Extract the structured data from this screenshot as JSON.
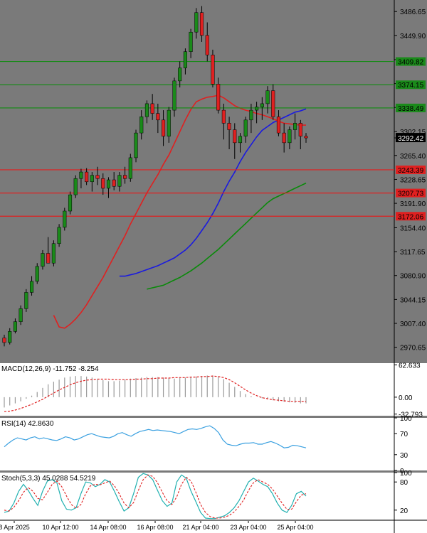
{
  "chart_data": [
    {
      "type": "candlestick",
      "panel": "price",
      "ylim": [
        2955,
        3500
      ],
      "y_ticks": [
        "3486.65",
        "3449.90",
        "3412.75",
        "3375.90",
        "3339.15",
        "3302.15",
        "3265.40",
        "3228.65",
        "3191.90",
        "3154.40",
        "3117.65",
        "3080.90",
        "3044.15",
        "3007.40",
        "2970.65"
      ],
      "last_price": "3292.42",
      "last_price_color": "#000000",
      "up_color": "#1a8a1a",
      "down_color": "#e02020",
      "candles": [
        [
          2985,
          2990,
          2972,
          2978
        ],
        [
          2978,
          3000,
          2975,
          2995
        ],
        [
          2995,
          3015,
          2992,
          3010
        ],
        [
          3010,
          3035,
          3005,
          3030
        ],
        [
          3030,
          3060,
          3025,
          3055
        ],
        [
          3055,
          3080,
          3050,
          3072
        ],
        [
          3072,
          3100,
          3068,
          3095
        ],
        [
          3095,
          3120,
          3090,
          3115
        ],
        [
          3115,
          3140,
          3110,
          3100
        ],
        [
          3100,
          3135,
          3095,
          3130
        ],
        [
          3130,
          3160,
          3125,
          3155
        ],
        [
          3155,
          3185,
          3150,
          3180
        ],
        [
          3180,
          3210,
          3175,
          3205
        ],
        [
          3205,
          3235,
          3200,
          3230
        ],
        [
          3230,
          3245,
          3215,
          3240
        ],
        [
          3240,
          3246,
          3220,
          3225
        ],
        [
          3225,
          3240,
          3210,
          3235
        ],
        [
          3235,
          3248,
          3220,
          3230
        ],
        [
          3230,
          3238,
          3205,
          3215
        ],
        [
          3215,
          3232,
          3200,
          3228
        ],
        [
          3228,
          3240,
          3212,
          3218
        ],
        [
          3218,
          3240,
          3210,
          3235
        ],
        [
          3235,
          3248,
          3222,
          3230
        ],
        [
          3230,
          3268,
          3225,
          3262
        ],
        [
          3262,
          3305,
          3255,
          3300
        ],
        [
          3300,
          3335,
          3290,
          3325
        ],
        [
          3325,
          3350,
          3315,
          3345
        ],
        [
          3345,
          3360,
          3320,
          3330
        ],
        [
          3330,
          3345,
          3300,
          3320
        ],
        [
          3320,
          3335,
          3280,
          3295
        ],
        [
          3295,
          3340,
          3285,
          3335
        ],
        [
          3335,
          3385,
          3325,
          3380
        ],
        [
          3380,
          3410,
          3370,
          3400
        ],
        [
          3400,
          3430,
          3390,
          3425
        ],
        [
          3425,
          3460,
          3415,
          3455
        ],
        [
          3455,
          3492,
          3445,
          3485
        ],
        [
          3485,
          3495,
          3440,
          3450
        ],
        [
          3450,
          3470,
          3410,
          3420
        ],
        [
          3420,
          3428,
          3370,
          3375
        ],
        [
          3375,
          3385,
          3330,
          3335
        ],
        [
          3335,
          3345,
          3290,
          3315
        ],
        [
          3315,
          3325,
          3275,
          3305
        ],
        [
          3305,
          3315,
          3260,
          3285
        ],
        [
          3285,
          3300,
          3270,
          3295
        ],
        [
          3295,
          3325,
          3285,
          3320
        ],
        [
          3320,
          3345,
          3300,
          3335
        ],
        [
          3335,
          3348,
          3315,
          3340
        ],
        [
          3340,
          3355,
          3320,
          3345
        ],
        [
          3345,
          3372,
          3330,
          3365
        ],
        [
          3365,
          3375,
          3320,
          3325
        ],
        [
          3325,
          3335,
          3295,
          3300
        ],
        [
          3300,
          3315,
          3270,
          3285
        ],
        [
          3285,
          3310,
          3275,
          3305
        ],
        [
          3305,
          3330,
          3290,
          3315
        ],
        [
          3315,
          3320,
          3275,
          3295
        ],
        [
          3295,
          3300,
          3285,
          3292.42
        ]
      ],
      "ma_red": [
        3020,
        3002,
        3000,
        3006,
        3014,
        3024,
        3036,
        3050,
        3064,
        3078,
        3094,
        3110,
        3126,
        3142,
        3160,
        3176,
        3192,
        3208,
        3222,
        3236,
        3252,
        3266,
        3284,
        3302,
        3320,
        3336,
        3348,
        3352,
        3355,
        3356,
        3358,
        3354,
        3348,
        3342,
        3338,
        3335,
        3333,
        3330,
        3328,
        3325,
        3322,
        3318,
        3315,
        3314,
        3313,
        3312,
        3312
      ],
      "ma_blue": [
        3080,
        3080,
        3082,
        3084,
        3087,
        3090,
        3093,
        3096,
        3100,
        3104,
        3108,
        3114,
        3120,
        3128,
        3138,
        3150,
        3162,
        3176,
        3192,
        3210,
        3226,
        3240,
        3256,
        3270,
        3282,
        3294,
        3304,
        3310,
        3316,
        3320,
        3324,
        3328,
        3332,
        3334,
        3337
      ],
      "ma_green": [
        3060,
        3062,
        3064,
        3066,
        3070,
        3074,
        3078,
        3083,
        3088,
        3094,
        3100,
        3107,
        3114,
        3121,
        3129,
        3137,
        3145,
        3153,
        3161,
        3169,
        3177,
        3185,
        3193,
        3199,
        3203,
        3207,
        3211,
        3215,
        3219,
        3223
      ],
      "hlines": [
        {
          "value": 3409.82,
          "label": "3409.82",
          "color": "#1a8a1a"
        },
        {
          "value": 3374.15,
          "label": "3374.15",
          "color": "#1a8a1a"
        },
        {
          "value": 3338.49,
          "label": "3338.49",
          "color": "#1a8a1a"
        },
        {
          "value": 3243.39,
          "label": "3243.39",
          "color": "#e02020"
        },
        {
          "value": 3207.73,
          "label": "3207.73",
          "color": "#e02020"
        },
        {
          "value": 3172.06,
          "label": "3172.06",
          "color": "#e02020"
        }
      ]
    },
    {
      "type": "bar",
      "panel": "macd",
      "title": "MACD(12,26,9) -11.752 -8.254",
      "ylim": [
        -36,
        66
      ],
      "y_ticks": [
        "62.633",
        "0.00",
        "-32.793"
      ],
      "histogram": [
        -20,
        -16,
        -12,
        -8,
        -3,
        3,
        10,
        18,
        25,
        30,
        34,
        38,
        40,
        41,
        41,
        40,
        38,
        35,
        33,
        31,
        31,
        32,
        34,
        36,
        37,
        38,
        39,
        39,
        39,
        38,
        37,
        36,
        37,
        38,
        39,
        40,
        41,
        42,
        42,
        40,
        35,
        28,
        20,
        12,
        6,
        2,
        0,
        -2,
        -4,
        -6,
        -8,
        -9,
        -10,
        -11,
        -12,
        -12
      ],
      "signal": [
        -28,
        -27,
        -25,
        -22,
        -18,
        -14,
        -9,
        -4,
        2,
        8,
        14,
        19,
        24,
        28,
        31,
        33,
        34,
        35,
        35,
        35,
        34,
        34,
        34,
        34,
        35,
        35,
        36,
        36,
        37,
        37,
        37,
        38,
        38,
        38,
        39,
        39,
        40,
        40,
        41,
        40,
        38,
        34,
        28,
        21,
        14,
        8,
        3,
        -1,
        -3,
        -5,
        -6,
        -7,
        -8,
        -8,
        -8,
        -8.3
      ]
    },
    {
      "type": "line",
      "panel": "rsi",
      "title": "RSI(14) 42.8630",
      "ylim": [
        0,
        100
      ],
      "y_ticks": [
        "100",
        "70",
        "30",
        "0"
      ],
      "values": [
        45,
        52,
        58,
        62,
        60,
        58,
        62,
        64,
        60,
        62,
        60,
        58,
        57,
        60,
        64,
        62,
        58,
        60,
        64,
        68,
        70,
        67,
        64,
        63,
        62,
        65,
        70,
        72,
        68,
        65,
        70,
        74,
        76,
        78,
        76,
        77,
        76,
        75,
        74,
        72,
        70,
        74,
        78,
        79,
        78,
        80,
        83,
        85,
        80,
        72,
        58,
        50,
        48,
        47,
        50,
        52,
        52,
        53,
        50,
        50,
        53,
        55,
        52,
        48,
        43,
        44,
        48,
        47,
        45,
        43
      ]
    },
    {
      "type": "line",
      "panel": "stoch",
      "title": "Stoch(5,3,3) 45.0288 54.5219",
      "ylim": [
        0,
        100
      ],
      "y_ticks": [
        "100",
        "80",
        "20"
      ],
      "k": [
        15,
        18,
        35,
        60,
        75,
        62,
        45,
        30,
        60,
        82,
        85,
        78,
        40,
        22,
        20,
        25,
        55,
        80,
        78,
        70,
        75,
        85,
        80,
        60,
        38,
        18,
        25,
        55,
        90,
        98,
        95,
        85,
        62,
        40,
        28,
        35,
        80,
        95,
        88,
        60,
        38,
        15,
        3,
        2,
        2,
        5,
        8,
        15,
        25,
        40,
        60,
        80,
        88,
        82,
        75,
        70,
        55,
        35,
        20,
        15,
        30,
        55,
        60,
        50
      ],
      "d": [
        20,
        18,
        26,
        40,
        58,
        68,
        60,
        45,
        42,
        58,
        75,
        82,
        70,
        50,
        32,
        24,
        32,
        55,
        72,
        75,
        74,
        78,
        82,
        72,
        55,
        35,
        25,
        36,
        62,
        85,
        95,
        92,
        78,
        58,
        40,
        32,
        48,
        75,
        90,
        82,
        58,
        32,
        15,
        6,
        3,
        3,
        5,
        9,
        16,
        28,
        42,
        62,
        78,
        85,
        80,
        75,
        65,
        50,
        35,
        22,
        22,
        38,
        52,
        55
      ]
    }
  ],
  "x_axis": {
    "labels": [
      "8 Apr 2025",
      "10 Apr 12:00",
      "14 Apr 08:00",
      "16 Apr 08:00",
      "21 Apr 04:00",
      "23 Apr 04:00",
      "25 Apr 04:00"
    ]
  }
}
